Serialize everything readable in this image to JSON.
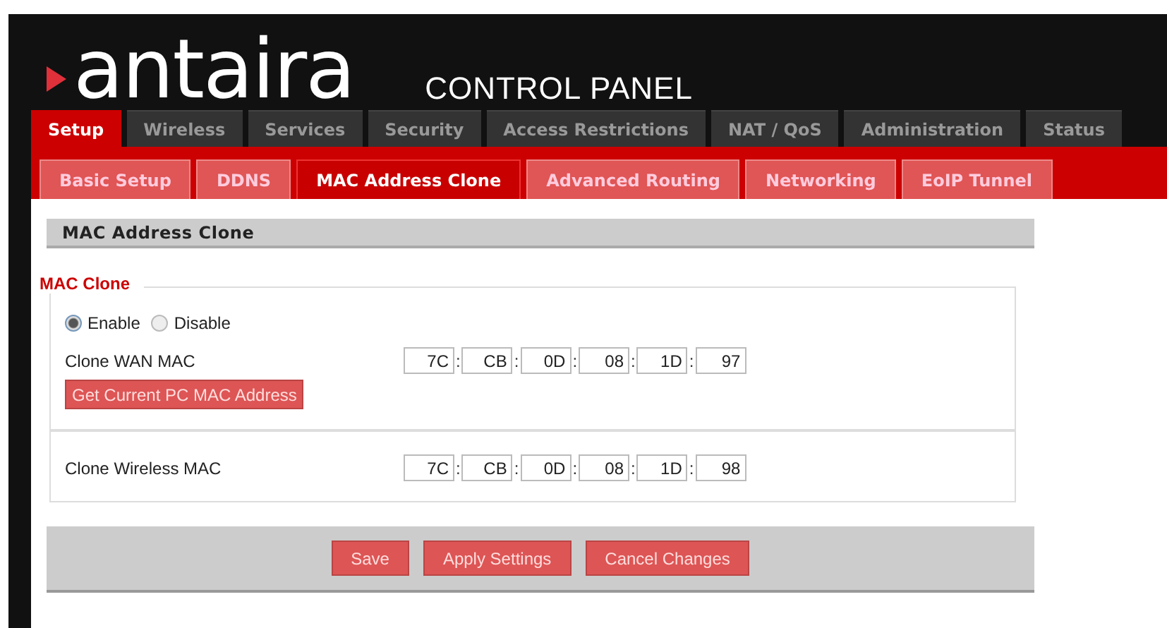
{
  "header": {
    "logo": "antaira",
    "title": "CONTROL PANEL"
  },
  "tabs": [
    {
      "label": "Setup",
      "selected": true
    },
    {
      "label": "Wireless",
      "selected": false
    },
    {
      "label": "Services",
      "selected": false
    },
    {
      "label": "Security",
      "selected": false
    },
    {
      "label": "Access Restrictions",
      "selected": false
    },
    {
      "label": "NAT / QoS",
      "selected": false
    },
    {
      "label": "Administration",
      "selected": false
    },
    {
      "label": "Status",
      "selected": false
    }
  ],
  "subtabs": [
    {
      "label": "Basic Setup",
      "selected": false
    },
    {
      "label": "DDNS",
      "selected": false
    },
    {
      "label": "MAC Address Clone",
      "selected": true
    },
    {
      "label": "Advanced Routing",
      "selected": false
    },
    {
      "label": "Networking",
      "selected": false
    },
    {
      "label": "EoIP Tunnel",
      "selected": false
    }
  ],
  "section": {
    "title": "MAC Address Clone",
    "legend": "MAC Clone",
    "options": [
      {
        "label": "Enable",
        "selected": true
      },
      {
        "label": "Disable",
        "selected": false
      }
    ],
    "rows": [
      {
        "label": "Clone WAN MAC",
        "separators": [
          ":",
          ":",
          ":",
          ":",
          ":"
        ],
        "octets": [
          "7C",
          "CB",
          "0D",
          "08",
          "1D",
          "97"
        ],
        "button": "Get Current PC MAC Address"
      },
      {
        "label": "Clone Wireless MAC",
        "separators": [
          ":",
          ":",
          ":",
          ":",
          ":"
        ],
        "octets": [
          "7C",
          "CB",
          "0D",
          "08",
          "1D",
          "98"
        ]
      }
    ]
  },
  "footer": {
    "buttons": [
      "Save",
      "Apply Settings",
      "Cancel Changes"
    ]
  }
}
